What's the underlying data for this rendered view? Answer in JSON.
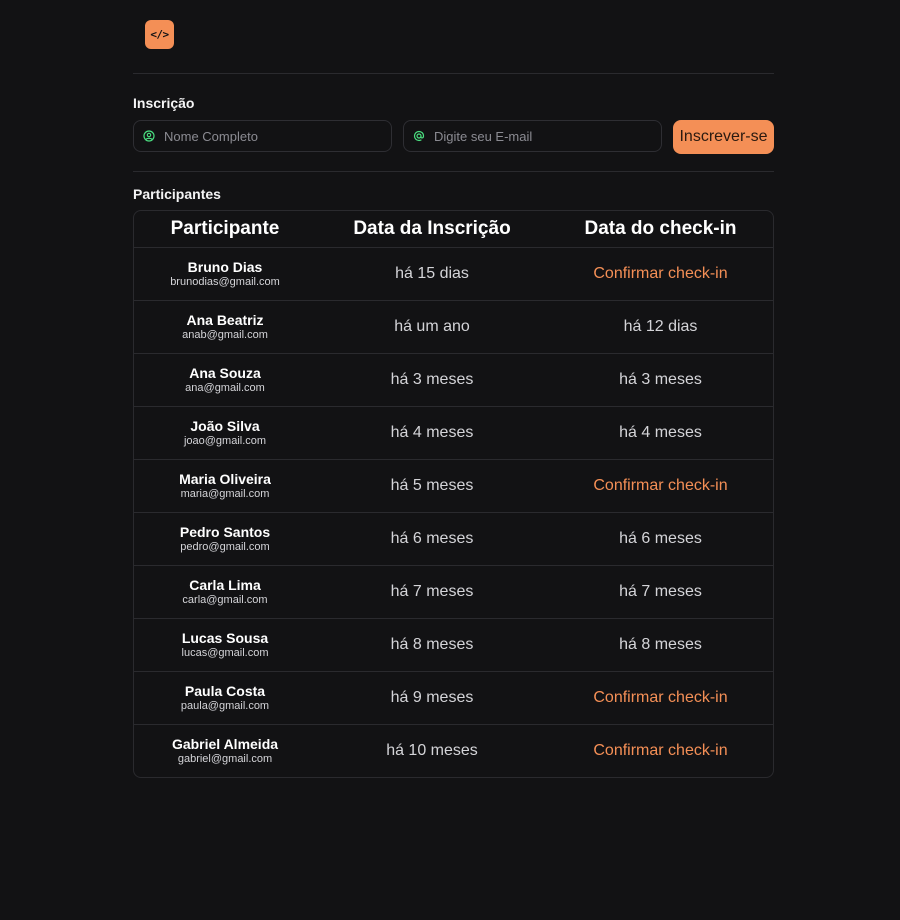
{
  "header": {
    "logo_text": "</>",
    "logo_color": "#f48f56"
  },
  "signup": {
    "title": "Inscrição",
    "name_placeholder": "Nome Completo",
    "email_placeholder": "Digite seu E-mail",
    "name_icon": "user-circle-icon",
    "email_icon": "at-sign-icon",
    "button_label": "Inscrever-se"
  },
  "participants": {
    "title": "Participantes",
    "columns": [
      "Participante",
      "Data da Inscrição",
      "Data do check-in"
    ],
    "rows": [
      {
        "name": "Bruno Dias",
        "email": "brunodias@gmail.com",
        "subscribed": "há 15 dias",
        "checkin": "Confirmar check-in",
        "checkin_pending": true
      },
      {
        "name": "Ana Beatriz",
        "email": "anab@gmail.com",
        "subscribed": "há um ano",
        "checkin": "há 12 dias",
        "checkin_pending": false
      },
      {
        "name": "Ana Souza",
        "email": "ana@gmail.com",
        "subscribed": "há 3 meses",
        "checkin": "há 3 meses",
        "checkin_pending": false
      },
      {
        "name": "João Silva",
        "email": "joao@gmail.com",
        "subscribed": "há 4 meses",
        "checkin": "há 4 meses",
        "checkin_pending": false
      },
      {
        "name": "Maria Oliveira",
        "email": "maria@gmail.com",
        "subscribed": "há 5 meses",
        "checkin": "Confirmar check-in",
        "checkin_pending": true
      },
      {
        "name": "Pedro Santos",
        "email": "pedro@gmail.com",
        "subscribed": "há 6 meses",
        "checkin": "há 6 meses",
        "checkin_pending": false
      },
      {
        "name": "Carla Lima",
        "email": "carla@gmail.com",
        "subscribed": "há 7 meses",
        "checkin": "há 7 meses",
        "checkin_pending": false
      },
      {
        "name": "Lucas Sousa",
        "email": "lucas@gmail.com",
        "subscribed": "há 8 meses",
        "checkin": "há 8 meses",
        "checkin_pending": false
      },
      {
        "name": "Paula Costa",
        "email": "paula@gmail.com",
        "subscribed": "há 9 meses",
        "checkin": "Confirmar check-in",
        "checkin_pending": true
      },
      {
        "name": "Gabriel Almeida",
        "email": "gabriel@gmail.com",
        "subscribed": "há 10 meses",
        "checkin": "Confirmar check-in",
        "checkin_pending": true
      }
    ]
  },
  "colors": {
    "background": "#121214",
    "accent": "#f48f56",
    "icon_green": "#4ade80",
    "border": "#2a2a2e"
  }
}
